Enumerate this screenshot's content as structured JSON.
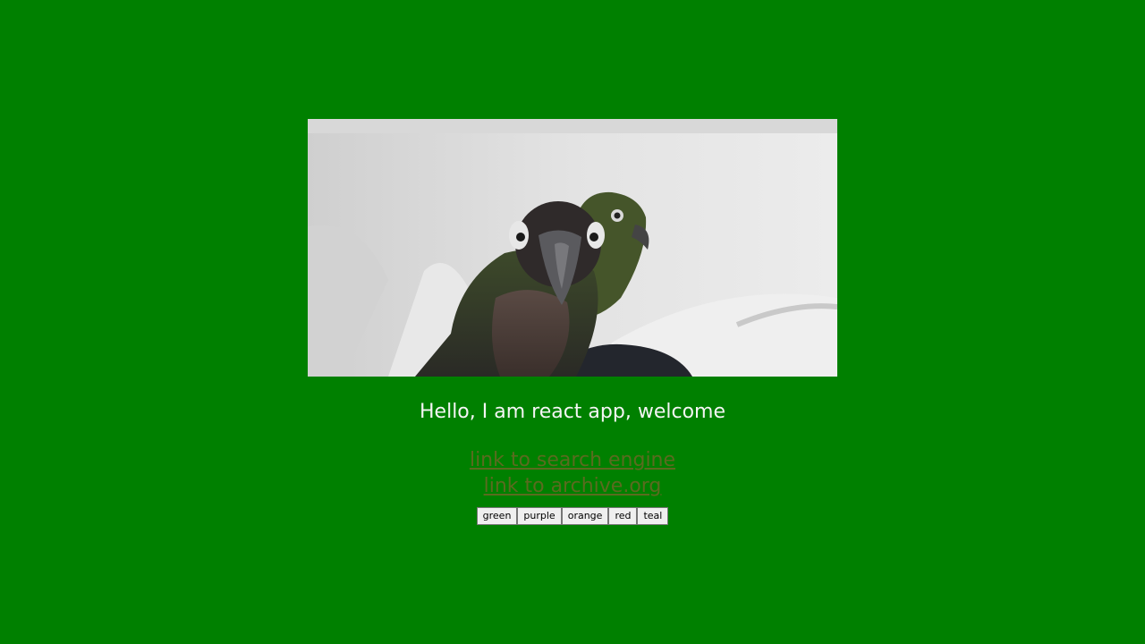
{
  "image": {
    "alt": "",
    "subject": "two parrots"
  },
  "greeting": "Hello, I am react app, welcome",
  "links": [
    {
      "label": "link to search engine"
    },
    {
      "label": "link to archive.org"
    }
  ],
  "color_buttons": [
    {
      "label": "green"
    },
    {
      "label": "purple"
    },
    {
      "label": "orange"
    },
    {
      "label": "red"
    },
    {
      "label": "teal"
    }
  ],
  "colors": {
    "background": "#008000",
    "greeting_text": "#f5f5f5",
    "link": "#5a6b1f"
  }
}
